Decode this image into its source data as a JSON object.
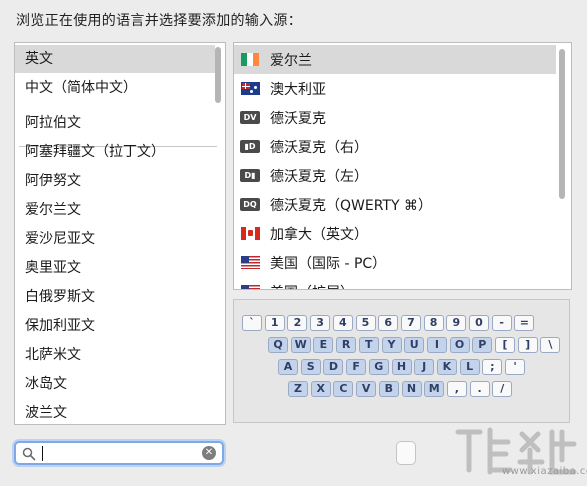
{
  "instruction": "浏览正在使用的语言并选择要添加的输入源：",
  "languages": [
    {
      "label": "英文",
      "selected": true
    },
    {
      "label": "中文（简体中文）",
      "selected": false
    },
    {
      "label": "阿拉伯文",
      "selected": false
    },
    {
      "label": "阿塞拜疆文（拉丁文）",
      "selected": false
    },
    {
      "label": "阿伊努文",
      "selected": false
    },
    {
      "label": "爱尔兰文",
      "selected": false
    },
    {
      "label": "爱沙尼亚文",
      "selected": false
    },
    {
      "label": "奥里亚文",
      "selected": false
    },
    {
      "label": "白俄罗斯文",
      "selected": false
    },
    {
      "label": "保加利亚文",
      "selected": false
    },
    {
      "label": "北萨米文",
      "selected": false
    },
    {
      "label": "冰岛文",
      "selected": false
    },
    {
      "label": "波兰文",
      "selected": false
    }
  ],
  "input_sources": [
    {
      "label": "爱尔兰",
      "icon": "flag-ireland-icon",
      "selected": true
    },
    {
      "label": "澳大利亚",
      "icon": "flag-australia-icon",
      "selected": false
    },
    {
      "label": "德沃夏克",
      "icon": "dvorak-icon",
      "tag": "DV",
      "selected": false
    },
    {
      "label": "德沃夏克（右）",
      "icon": "dvorak-right-icon",
      "tag": "▮D",
      "selected": false
    },
    {
      "label": "德沃夏克（左）",
      "icon": "dvorak-left-icon",
      "tag": "D▮",
      "selected": false
    },
    {
      "label": "德沃夏克（QWERTY ⌘）",
      "icon": "dvorak-qwerty-icon",
      "tag": "DQ",
      "selected": false
    },
    {
      "label": "加拿大（英文）",
      "icon": "flag-canada-icon",
      "selected": false
    },
    {
      "label": "美国（国际 - PC）",
      "icon": "flag-us-icon",
      "selected": false
    },
    {
      "label": "美国（扩展）",
      "icon": "flag-us-icon",
      "selected": false
    }
  ],
  "keyboard": {
    "rows": [
      [
        "`",
        "1",
        "2",
        "3",
        "4",
        "5",
        "6",
        "7",
        "8",
        "9",
        "0",
        "-",
        "="
      ],
      [
        "Q",
        "W",
        "E",
        "R",
        "T",
        "Y",
        "U",
        "I",
        "O",
        "P",
        "[",
        "]",
        "\\"
      ],
      [
        "A",
        "S",
        "D",
        "F",
        "G",
        "H",
        "J",
        "K",
        "L",
        ";",
        "'"
      ],
      [
        "Z",
        "X",
        "C",
        "V",
        "B",
        "N",
        "M",
        ",",
        ".",
        "/"
      ]
    ]
  },
  "search": {
    "value": "",
    "placeholder": ""
  },
  "watermark": {
    "text": "www.xiazaiba.com"
  },
  "colors": {
    "selection": "#d9d9d9",
    "focus_ring": "#7fa8e6",
    "letter_key": "#c4d3ec"
  }
}
